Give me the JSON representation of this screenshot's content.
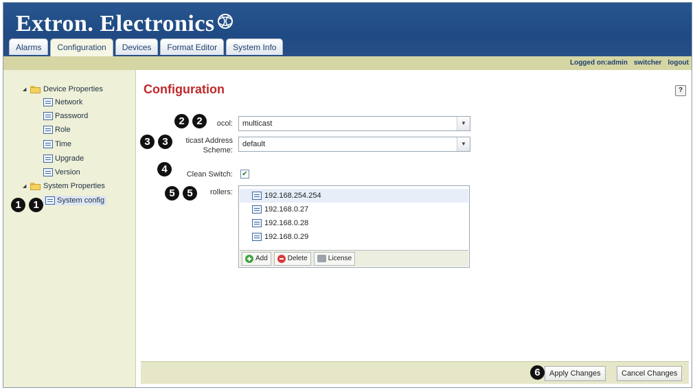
{
  "app": {
    "brand": "Extron. Electronics"
  },
  "tabs": [
    {
      "label": "Alarms"
    },
    {
      "label": "Configuration"
    },
    {
      "label": "Devices"
    },
    {
      "label": "Format Editor"
    },
    {
      "label": "System Info"
    }
  ],
  "infobar": {
    "logged_on": "Logged on:admin",
    "device": "switcher",
    "logout": "logout"
  },
  "sidebar": {
    "device_properties": "Device Properties",
    "device_items": [
      "Network",
      "Password",
      "Role",
      "Time",
      "Upgrade",
      "Version"
    ],
    "system_properties": "System Properties",
    "system_items": [
      "System config"
    ]
  },
  "main": {
    "title": "Configuration",
    "help": "?",
    "protocol_label": "ocol:",
    "protocol_value": "multicast",
    "mcast_label_1": "ticast Address",
    "mcast_label_2": "Scheme:",
    "mcast_value": "default",
    "clean_switch_label": "Clean Switch:",
    "clean_switch_checked": true,
    "controllers_label": "rollers:",
    "controllers": [
      "192.168.254.254",
      "192.168.0.27",
      "192.168.0.28",
      "192.168.0.29"
    ],
    "add_label": "Add",
    "delete_label": "Delete",
    "license_label": "License",
    "apply_label": "Apply Changes",
    "cancel_label": "Cancel Changes"
  },
  "callouts": [
    "1",
    "2",
    "3",
    "4",
    "5",
    "6"
  ],
  "colors": {
    "header_blue": "#21508a",
    "title_red": "#c0292b",
    "infobar_olive": "#d5d6a4",
    "sidebar_bg": "#eef0d7"
  }
}
